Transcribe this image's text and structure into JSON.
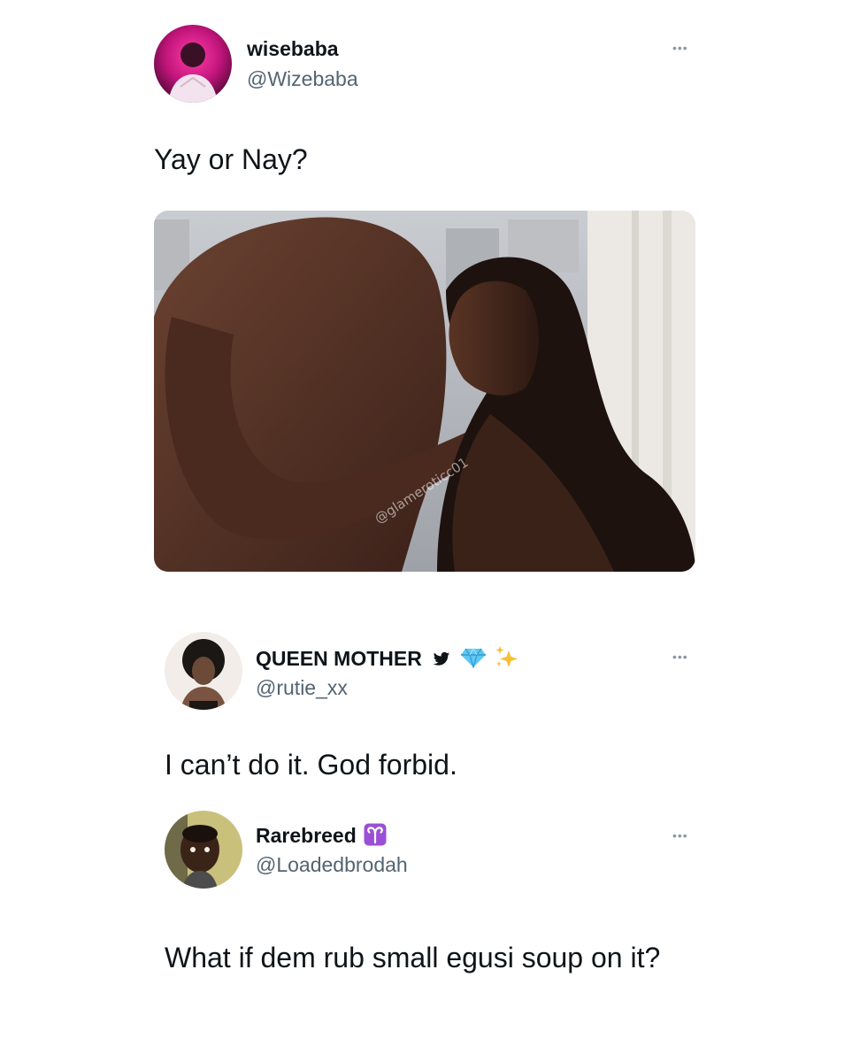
{
  "tweet_main": {
    "display_name": "wisebaba",
    "handle": "@Wizebaba",
    "text": "Yay or Nay?",
    "more_icon": "more-dots-icon",
    "media_watermark": "@glameroticc01"
  },
  "reply_1": {
    "display_name": "QUEEN MOTHER",
    "handle": "@rutie_xx",
    "text": "I can’t do it. God forbid.",
    "badges": [
      "twitter-bird-icon",
      "gem-icon",
      "sparkles-icon"
    ],
    "more_icon": "more-dots-icon"
  },
  "reply_2": {
    "display_name": "Rarebreed",
    "handle": "@Loadedbrodah",
    "text": "What if dem rub small egusi soup on it?",
    "badges": [
      "aries-icon"
    ],
    "more_icon": "more-dots-icon"
  },
  "colors": {
    "text_primary": "#0f1419",
    "text_secondary": "#536471",
    "aries_badge": "#9b4fd6",
    "twitter_blue": "#1d9bf0"
  }
}
